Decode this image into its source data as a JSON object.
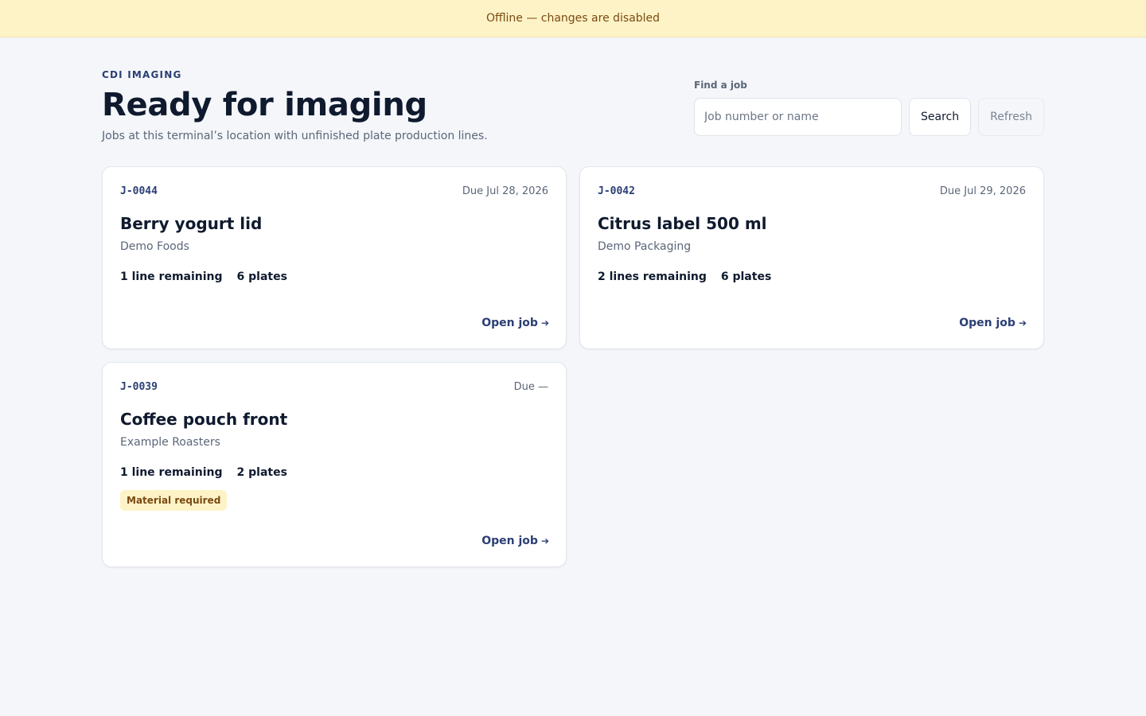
{
  "banner": {
    "text": "Offline — changes are disabled"
  },
  "header": {
    "eyebrow": "CDI IMAGING",
    "title": "Ready for imaging",
    "subtitle": "Jobs at this terminal’s location with unfinished plate production lines."
  },
  "search": {
    "label": "Find a job",
    "placeholder": "Job number or name",
    "value": "",
    "search_label": "Search",
    "refresh_label": "Refresh"
  },
  "jobs": [
    {
      "id": "J-0044",
      "due": "Due Jul 28, 2026",
      "name": "Berry yogurt lid",
      "customer": "Demo Foods",
      "lines": "1 line remaining",
      "plates": "6 plates",
      "badge": "",
      "link": "Open job"
    },
    {
      "id": "J-0042",
      "due": "Due Jul 29, 2026",
      "name": "Citrus label 500 ml",
      "customer": "Demo Packaging",
      "lines": "2 lines remaining",
      "plates": "6 plates",
      "badge": "",
      "link": "Open job"
    },
    {
      "id": "J-0039",
      "due": "Due —",
      "name": "Coffee pouch front",
      "customer": "Example Roasters",
      "lines": "1 line remaining",
      "plates": "2 plates",
      "badge": "Material required",
      "link": "Open job"
    }
  ],
  "colors": {
    "accent": "#2b3f75",
    "warning_bg": "#fef3c7",
    "warning_text": "#7a4a12"
  },
  "icons": {
    "open_job": "arrow-right-icon"
  }
}
